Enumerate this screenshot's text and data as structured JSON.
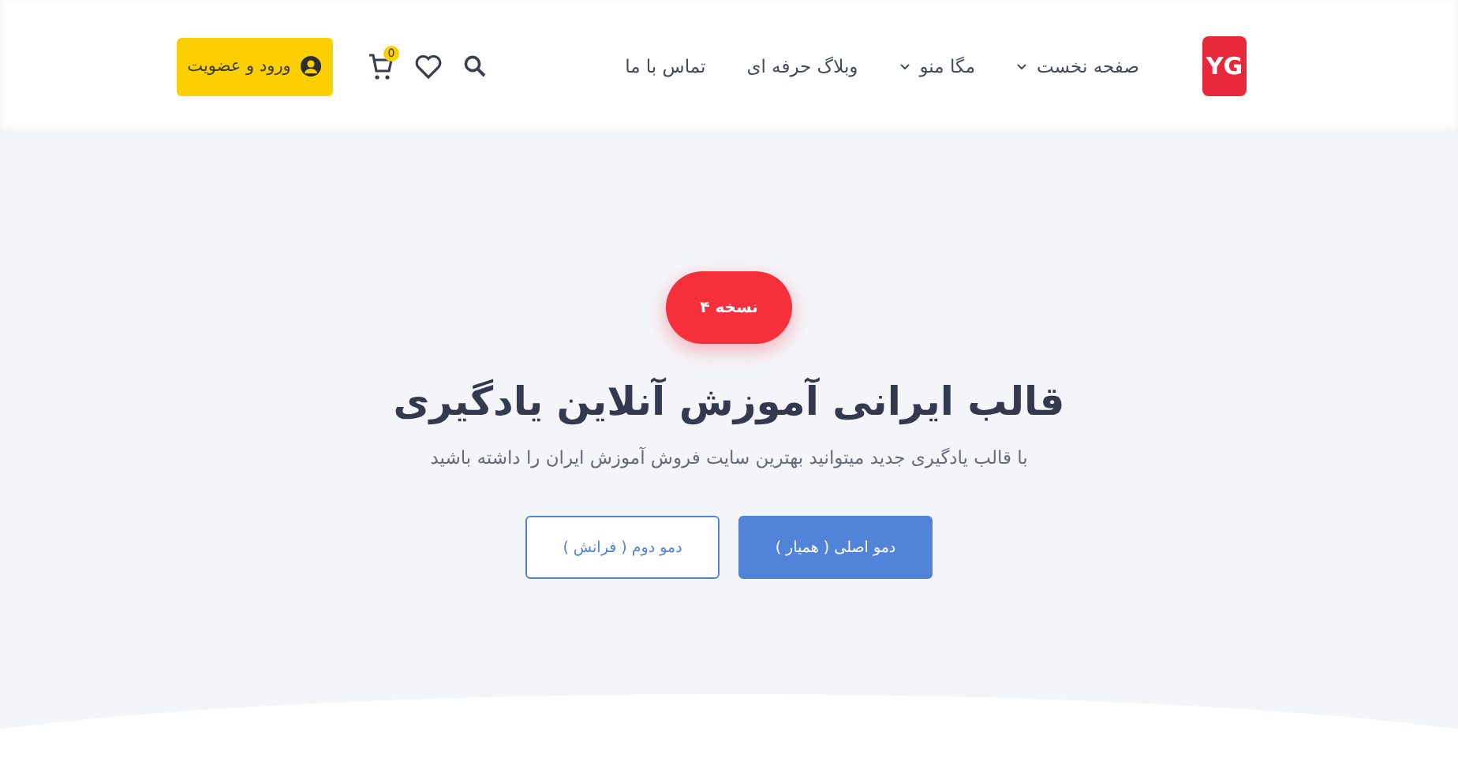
{
  "header": {
    "logo": "YG",
    "nav": [
      {
        "label": "صفحه نخست",
        "has_dropdown": true
      },
      {
        "label": "مگا منو",
        "has_dropdown": true
      },
      {
        "label": "وبلاگ حرفه ای",
        "has_dropdown": false
      },
      {
        "label": "تماس با ما",
        "has_dropdown": false
      }
    ],
    "cart_count": "0",
    "login_button": "ورود و عضویت"
  },
  "hero": {
    "badge": "نسخه ۴",
    "title": "قالب ایرانی آموزش آنلاین یادگیری",
    "subtitle": "با قالب یادگیری جدید میتوانید بهترین سایت فروش آموزش ایران را داشته باشید",
    "buttons": [
      {
        "label": "دمو اصلی ( همیار )",
        "kind": "primary"
      },
      {
        "label": "دمو دوم ( فرانش )",
        "kind": "outline"
      }
    ]
  }
}
